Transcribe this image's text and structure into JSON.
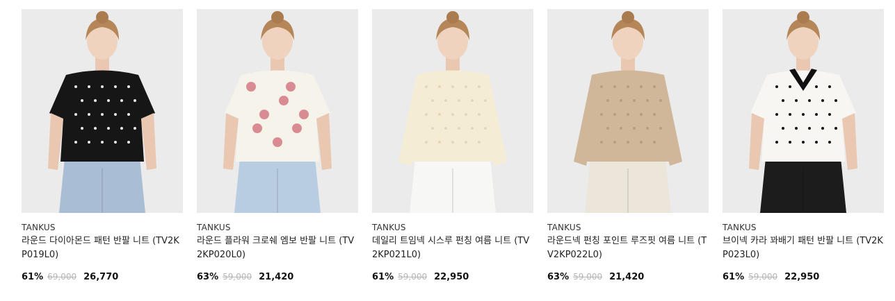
{
  "products": [
    {
      "brand": "TANKUS",
      "name": "라운드 다이아몬드 패턴 반팔 니트 (TV2KP019L0)",
      "discount": "61%",
      "original_price": "69,000",
      "sale_price": "26,770",
      "top_color": "#161616",
      "top_detail_color": "#e8e8e8",
      "bottom_color": "#a9bdd4",
      "bg_color": "#ebebeb",
      "sleeve": "short"
    },
    {
      "brand": "TANKUS",
      "name": "라운드 플라워 크로쉐 엠보 반팔 니트 (TV2KP020L0)",
      "discount": "63%",
      "original_price": "59,000",
      "sale_price": "21,420",
      "top_color": "#f6f3ea",
      "top_detail_color": "#d98b93",
      "bottom_color": "#b9cde2",
      "bg_color": "#ebebeb",
      "sleeve": "short"
    },
    {
      "brand": "TANKUS",
      "name": "데일리 트임넥 시스루 펀칭 여름 니트 (TV2KP021L0)",
      "discount": "61%",
      "original_price": "59,000",
      "sale_price": "22,950",
      "top_color": "#f4ecd5",
      "top_detail_color": "#e3d8b8",
      "bottom_color": "#f7f7f5",
      "bg_color": "#ebebeb",
      "sleeve": "long"
    },
    {
      "brand": "TANKUS",
      "name": "라운드넥 펀칭 포인트 루즈핏 여름 니트 (TV2KP022L0)",
      "discount": "63%",
      "original_price": "59,000",
      "sale_price": "21,420",
      "top_color": "#d0b79a",
      "top_detail_color": "#b89c7d",
      "bottom_color": "#ece6da",
      "bg_color": "#ebebeb",
      "sleeve": "long"
    },
    {
      "brand": "TANKUS",
      "name": "브이넥 카라 꽈배기 패턴 반팔 니트 (TV2KP023L0)",
      "discount": "61%",
      "original_price": "59,000",
      "sale_price": "22,950",
      "top_color": "#f7f6f2",
      "top_detail_color": "#111111",
      "bottom_color": "#1c1c1c",
      "bg_color": "#ebebeb",
      "sleeve": "short"
    }
  ]
}
